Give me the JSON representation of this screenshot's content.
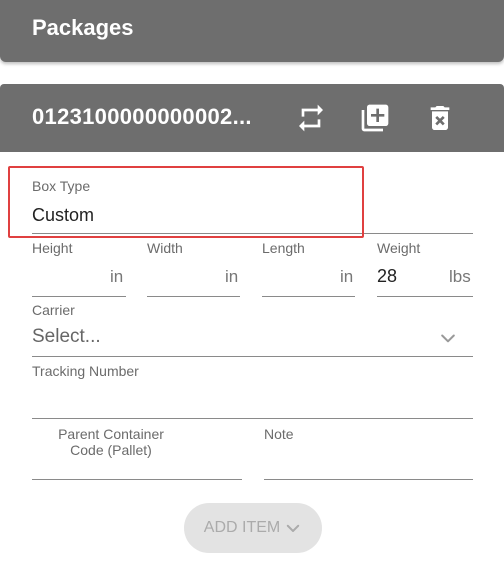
{
  "header": {
    "title": "Packages"
  },
  "package": {
    "id": "0123100000000002...",
    "actions": [
      "swap-icon",
      "add-box-icon",
      "delete-icon"
    ]
  },
  "box_type": {
    "label": "Box Type",
    "value": "Custom"
  },
  "dimensions": {
    "height": {
      "label": "Height",
      "value": "",
      "unit": "in"
    },
    "width": {
      "label": "Width",
      "value": "",
      "unit": "in"
    },
    "length": {
      "label": "Length",
      "value": "",
      "unit": "in"
    },
    "weight": {
      "label": "Weight",
      "value": "28",
      "unit": "lbs"
    }
  },
  "carrier": {
    "label": "Carrier",
    "placeholder": "Select..."
  },
  "tracking": {
    "label": "Tracking Number",
    "value": ""
  },
  "parent_container": {
    "label_line1": "Parent Container",
    "label_line2": "Code (Pallet)",
    "value": ""
  },
  "note": {
    "label": "Note",
    "value": ""
  },
  "add_item": {
    "label": "ADD ITEM"
  },
  "colors": {
    "bar": "#6e6e6e",
    "highlight": "#e04040",
    "button_bg": "#e3e3e3"
  }
}
